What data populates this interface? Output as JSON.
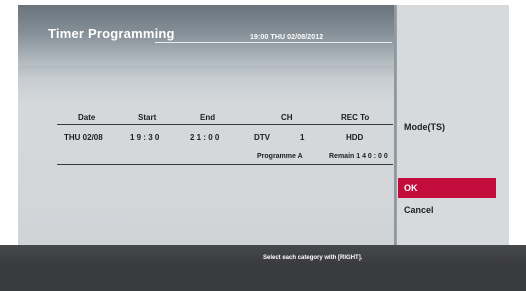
{
  "screen": {
    "title": "Timer Programming",
    "clock": "19:00  THU  02/08/2012"
  },
  "table": {
    "headers": {
      "date": "Date",
      "start": "Start",
      "end": "End",
      "ch": "CH",
      "rec_to": "REC To"
    },
    "row": {
      "date": "THU 02/08",
      "start": "1 9  :  3 0",
      "end": "2 1  :  0 0",
      "ch_type": "DTV",
      "ch_number": "1",
      "rec_to": "HDD",
      "programme": "Programme A",
      "remain": "Remain  1 4 0 : 0 0"
    }
  },
  "side_panel": {
    "mode_label": "Mode(TS)",
    "ok_label": "OK",
    "cancel_label": "Cancel"
  },
  "footer": {
    "hint": "Select each category with [RIGHT]."
  },
  "colors": {
    "selected_button": "#c20d3c",
    "bottom_bar": "#3a3b3d"
  }
}
